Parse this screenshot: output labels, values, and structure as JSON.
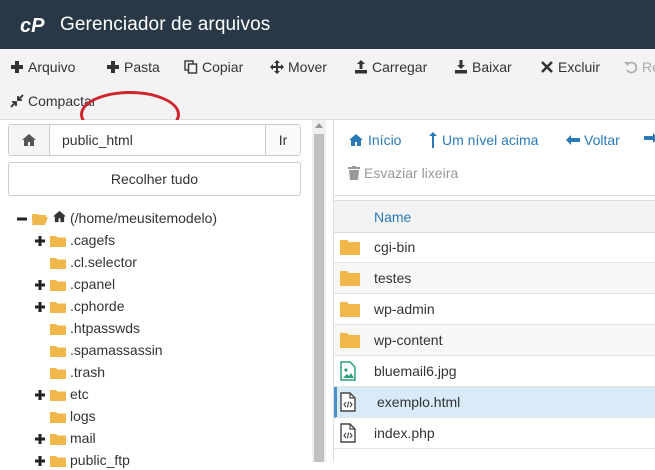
{
  "header": {
    "title": "Gerenciador de arquivos",
    "logo_text": "cP"
  },
  "toolbar": {
    "row1": [
      {
        "label": "Arquivo",
        "icon": "plus-icon"
      },
      {
        "label": "Pasta",
        "icon": "plus-icon"
      },
      {
        "label": "Copiar",
        "icon": "copy-icon"
      },
      {
        "label": "Mover",
        "icon": "move-icon"
      },
      {
        "label": "Carregar",
        "icon": "upload-icon"
      },
      {
        "label": "Baixar",
        "icon": "download-icon"
      },
      {
        "label": "Excluir",
        "icon": "close-icon"
      },
      {
        "label": "Re",
        "icon": "undo-icon"
      }
    ],
    "row2": [
      {
        "label": "Compactar",
        "icon": "compress-icon"
      }
    ]
  },
  "left": {
    "path_value": "public_html",
    "go_label": "Ir",
    "collapse_label": "Recolher tudo",
    "tree": [
      {
        "label": "(/home/meusitemodelo)",
        "toggle": "minus",
        "root": true
      },
      {
        "label": ".cagefs",
        "toggle": "plus"
      },
      {
        "label": ".cl.selector",
        "toggle": ""
      },
      {
        "label": ".cpanel",
        "toggle": "plus"
      },
      {
        "label": ".cphorde",
        "toggle": "plus"
      },
      {
        "label": ".htpasswds",
        "toggle": ""
      },
      {
        "label": ".spamassassin",
        "toggle": ""
      },
      {
        "label": ".trash",
        "toggle": ""
      },
      {
        "label": "etc",
        "toggle": "plus"
      },
      {
        "label": "logs",
        "toggle": ""
      },
      {
        "label": "mail",
        "toggle": "plus"
      },
      {
        "label": "public_ftp",
        "toggle": "plus"
      }
    ]
  },
  "right": {
    "nav": {
      "home": "Início",
      "up": "Um nível acima",
      "back": "Voltar"
    },
    "trash_label": "Esvaziar lixeira",
    "column_name": "Name",
    "files": [
      {
        "name": "cgi-bin",
        "type": "folder"
      },
      {
        "name": "testes",
        "type": "folder"
      },
      {
        "name": "wp-admin",
        "type": "folder"
      },
      {
        "name": "wp-content",
        "type": "folder"
      },
      {
        "name": "bluemail6.jpg",
        "type": "image"
      },
      {
        "name": "exemplo.html",
        "type": "code",
        "selected": true
      },
      {
        "name": "index.php",
        "type": "code"
      }
    ]
  },
  "colors": {
    "header_bg": "#283846",
    "toolbar_bg": "#f3f3f3",
    "link": "#2a7ab7",
    "folder": "#f0b84a",
    "highlight": "#d0242c",
    "selected_row": "#d9ebf7"
  }
}
